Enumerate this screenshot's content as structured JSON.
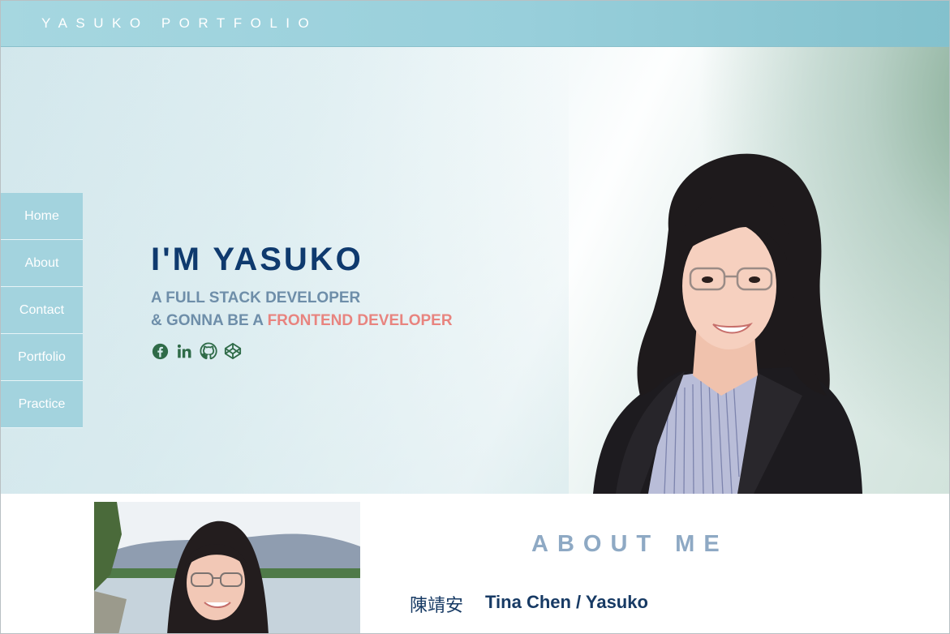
{
  "header": {
    "brand": "YASUKO PORTFOLIO"
  },
  "sidebar": {
    "items": [
      {
        "label": "Home"
      },
      {
        "label": "About"
      },
      {
        "label": "Contact"
      },
      {
        "label": "Portfolio"
      },
      {
        "label": "Practice"
      }
    ]
  },
  "hero": {
    "title": "I'M YASUKO",
    "line1": "A FULL STACK DEVELOPER",
    "line2_prefix": "& GONNA BE A ",
    "line2_accent": "FRONTEND DEVELOPER",
    "socials": [
      {
        "icon": "facebook-icon"
      },
      {
        "icon": "linkedin-icon"
      },
      {
        "icon": "github-icon"
      },
      {
        "icon": "codepen-icon"
      }
    ]
  },
  "about": {
    "title": "ABOUT ME",
    "name_cn": "陳靖安",
    "name_en": "Tina Chen / Yasuko"
  },
  "colors": {
    "topbar": "#98cfdb",
    "nav": "#a3d3de",
    "title": "#0f3a6e",
    "subtitle": "#6e8ea9",
    "accent": "#e8847f",
    "social": "#2f6b48"
  }
}
